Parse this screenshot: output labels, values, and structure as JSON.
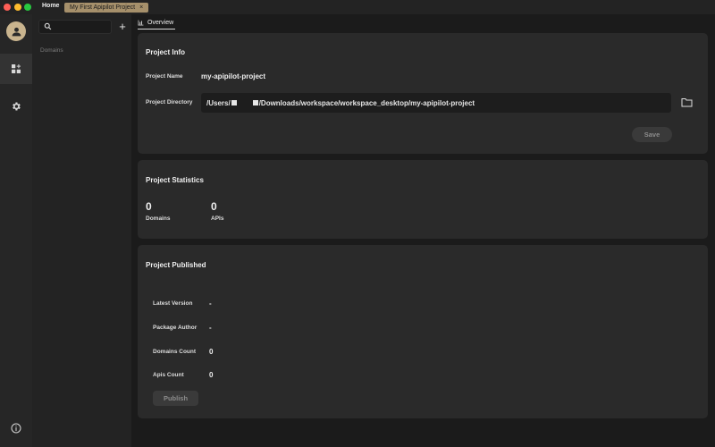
{
  "titlebar": {
    "tabs": [
      {
        "label": "Home"
      },
      {
        "label": "My First Apipilot Project",
        "close": "×"
      }
    ]
  },
  "sidebar": {
    "search": {
      "placeholder": "",
      "value": ""
    },
    "add_label": "+",
    "section_label": "Domains"
  },
  "main": {
    "tab_label": "Overview",
    "project_info": {
      "title": "Project Info",
      "name_label": "Project Name",
      "name_value": "my-apipilot-project",
      "dir_label": "Project Directory",
      "dir_prefix": "/Users/",
      "dir_suffix": "/Downloads/workspace/workspace_desktop/my-apipilot-project",
      "save_label": "Save"
    },
    "project_stats": {
      "title": "Project Statistics",
      "domains_count": "0",
      "domains_label": "Domains",
      "apis_count": "0",
      "apis_label": "APIs"
    },
    "project_published": {
      "title": "Project Published",
      "rows": [
        {
          "label": "Latest Version",
          "value": "-"
        },
        {
          "label": "Package Author",
          "value": "-"
        },
        {
          "label": "Domains Count",
          "value": "0"
        },
        {
          "label": "Apis Count",
          "value": "0"
        }
      ],
      "publish_label": "Publish"
    }
  },
  "colors": {
    "accent_tab": "#a6906b",
    "avatar": "#c9b48e",
    "card_bg": "#2a2a2a",
    "background": "#1b1b1b"
  },
  "icons": [
    "user-icon",
    "apps-add-icon",
    "gear-icon",
    "info-icon",
    "search-icon",
    "chart-icon",
    "folder-icon",
    "close-icon"
  ]
}
